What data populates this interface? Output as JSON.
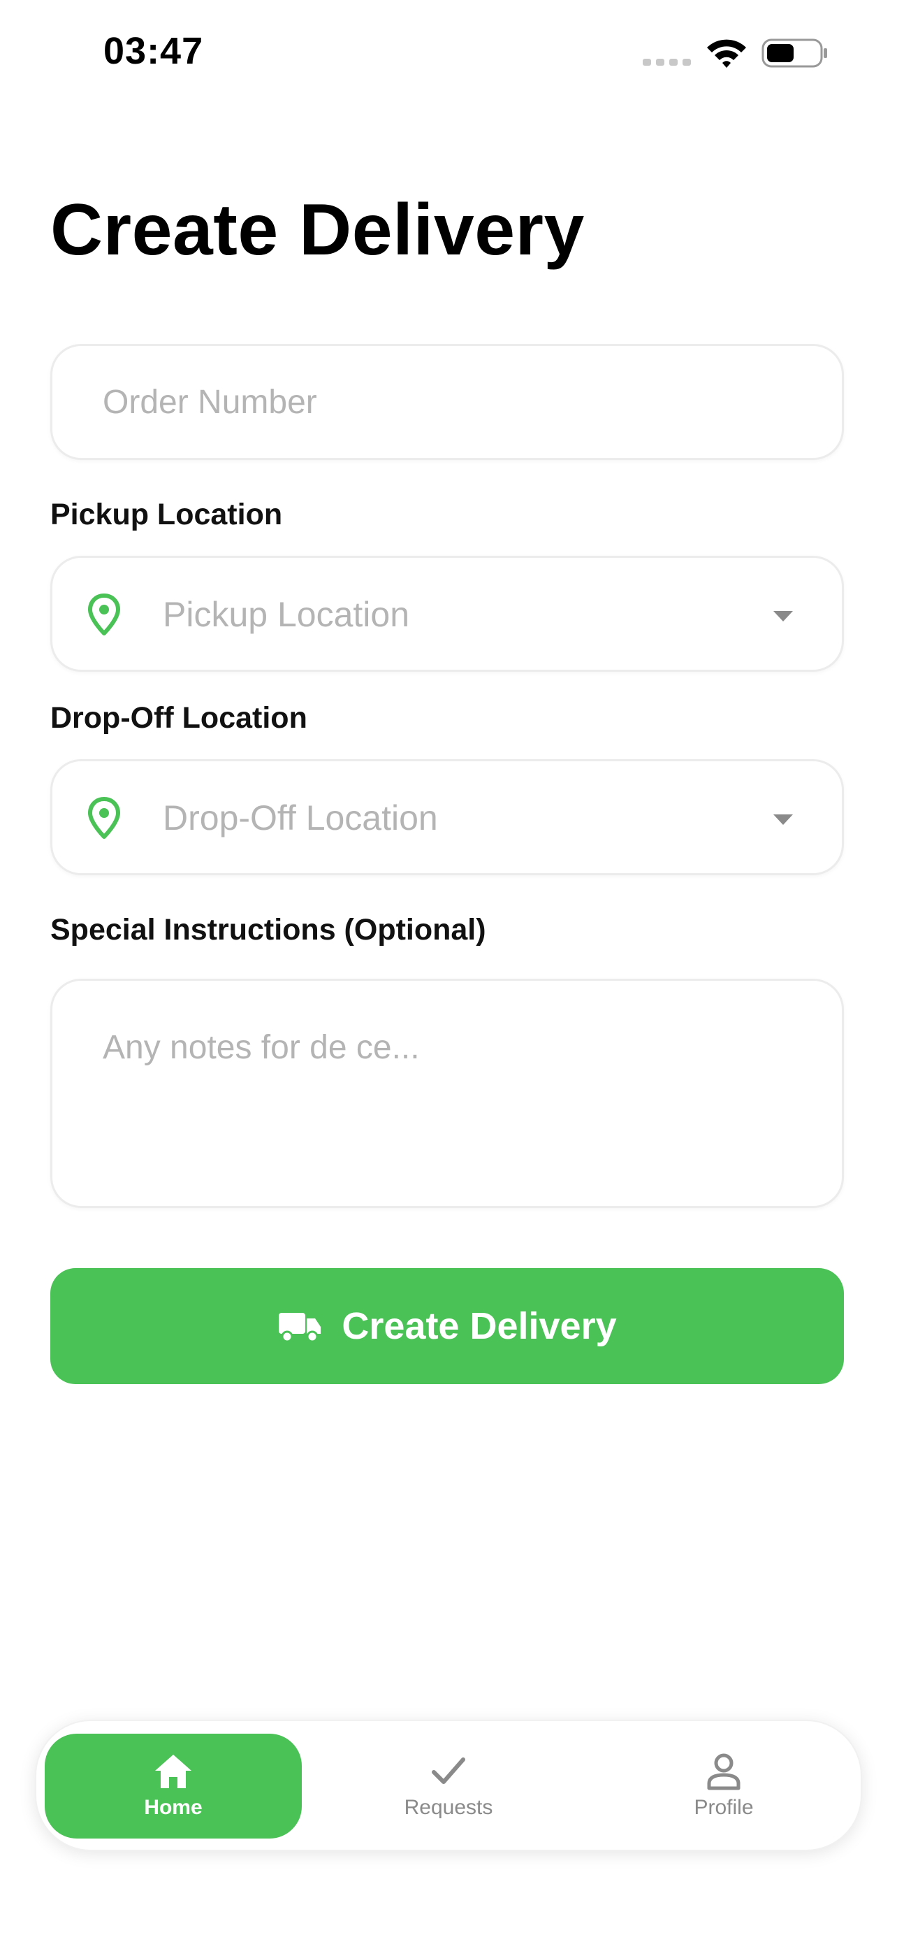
{
  "status_bar": {
    "time": "03:47"
  },
  "page": {
    "title": "Create Delivery"
  },
  "form": {
    "order_number": {
      "placeholder": "Order Number",
      "value": ""
    },
    "pickup": {
      "label": "Pickup Location",
      "placeholder": "Pickup Location"
    },
    "dropoff": {
      "label": "Drop-Off Location",
      "placeholder": "Drop-Off Location"
    },
    "notes": {
      "label": "Special Instructions (Optional)",
      "placeholder": "Any notes for de ce..."
    },
    "submit_label": "Create Delivery"
  },
  "tabs": [
    {
      "label": "Home",
      "icon": "home-icon",
      "active": true
    },
    {
      "label": "Requests",
      "icon": "checkmark-icon",
      "active": false
    },
    {
      "label": "Profile",
      "icon": "person-icon",
      "active": false
    }
  ],
  "colors": {
    "accent": "#4ac256",
    "placeholder": "#b4b4b4",
    "inactive_tab": "#8a8a8a"
  }
}
